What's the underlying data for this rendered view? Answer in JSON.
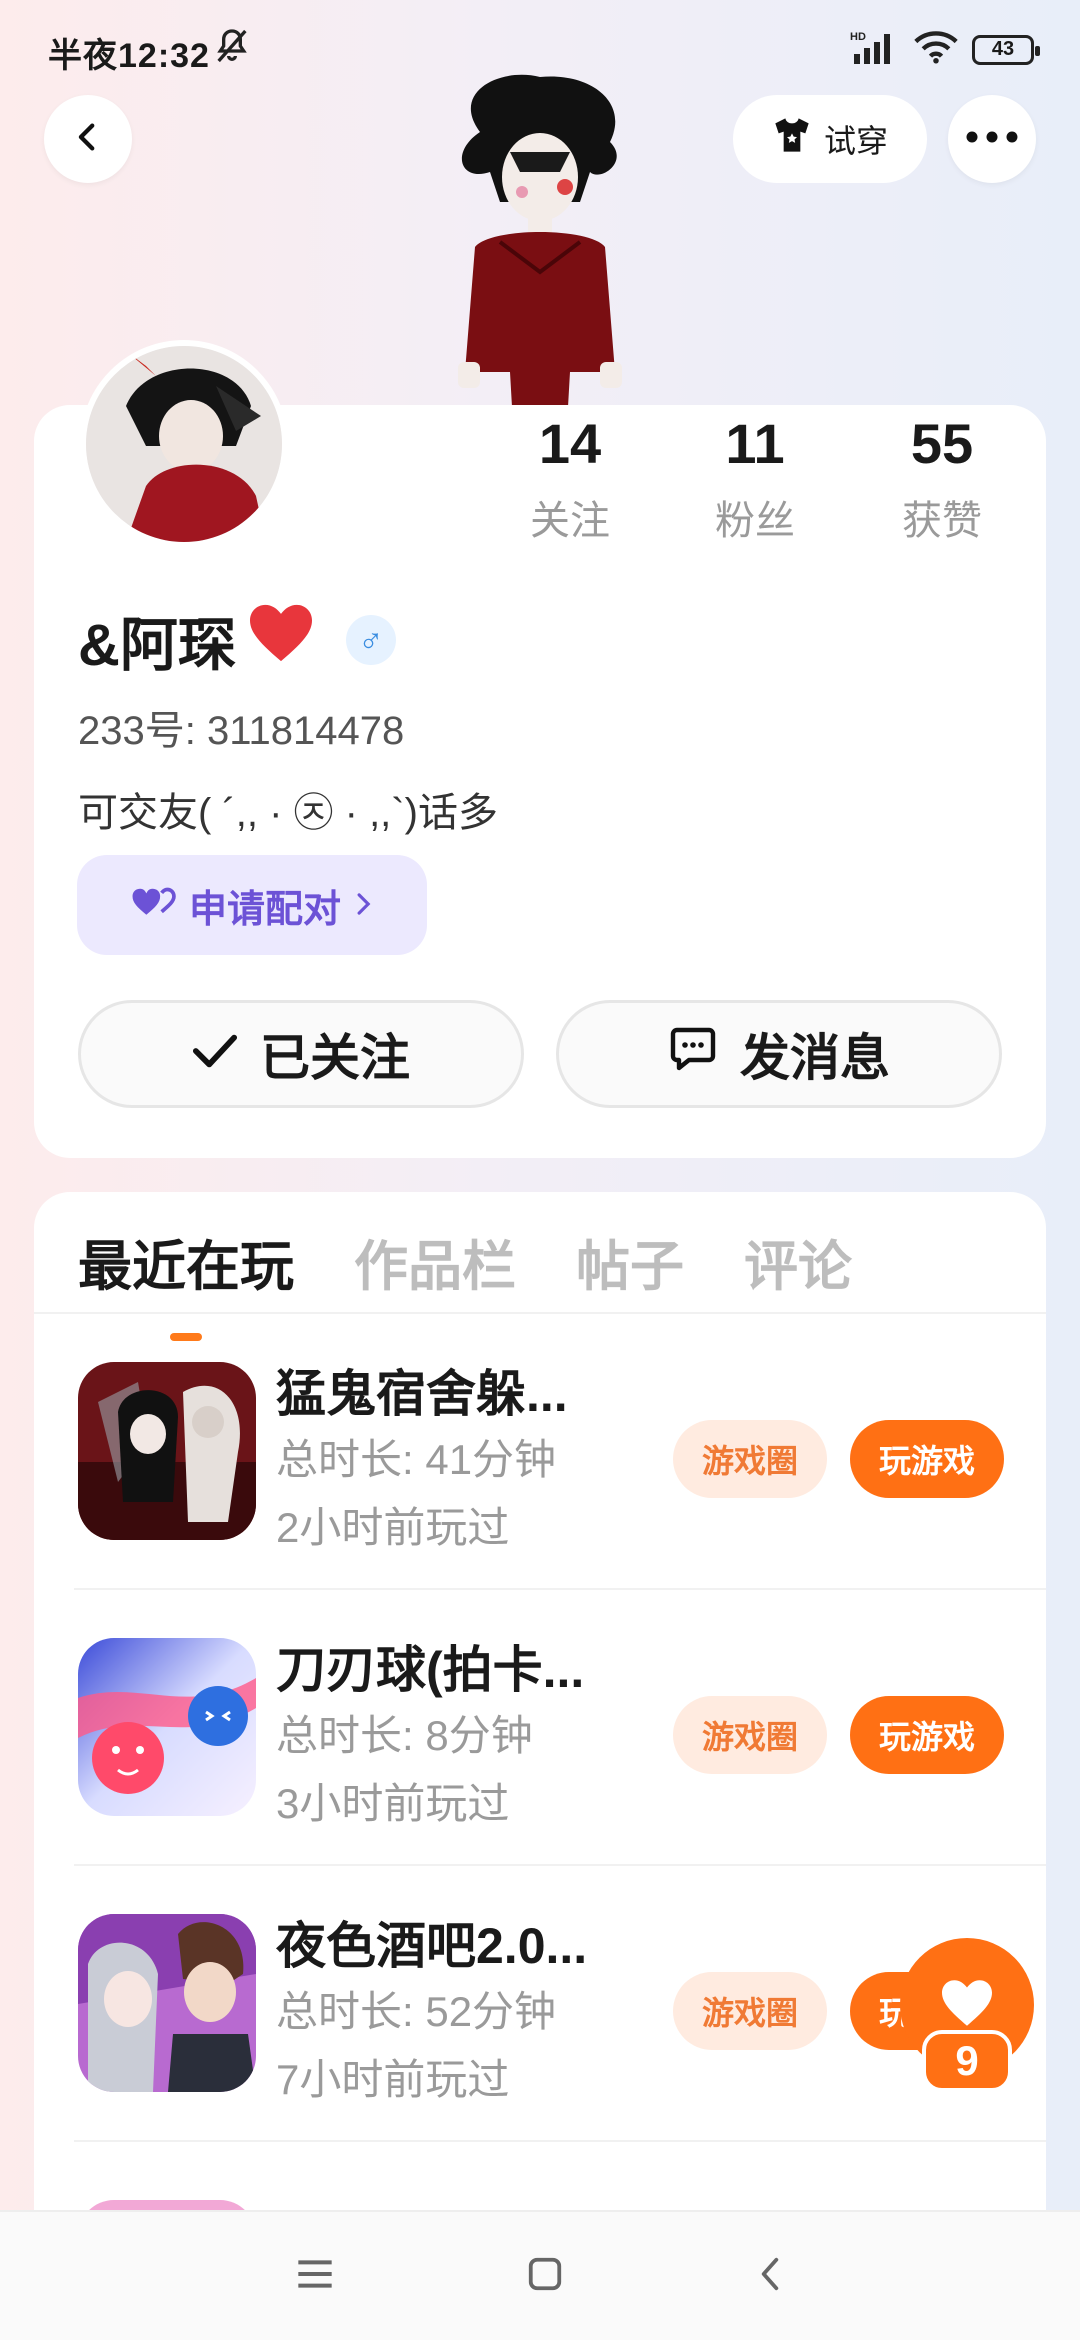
{
  "status_bar": {
    "time": "半夜12:32",
    "battery": "43",
    "hd": "HD"
  },
  "header": {
    "tryon_label": "试穿"
  },
  "profile": {
    "stats": [
      {
        "value": "14",
        "label": "关注"
      },
      {
        "value": "11",
        "label": "粉丝"
      },
      {
        "value": "55",
        "label": "获赞"
      }
    ],
    "nickname": "&阿琛",
    "nickname_emoji": "❤️",
    "gender_symbol": "♂",
    "uid": "233号: 311814478",
    "bio": "可交友( ´,, · ㉨ · ,,`)话多",
    "pair_label": "申请配对",
    "follow_label": "已关注",
    "message_label": "发消息"
  },
  "tabs": [
    "最近在玩",
    "作品栏",
    "帖子",
    "评论"
  ],
  "games": [
    {
      "name": "猛鬼宿舍躲...",
      "duration": "总时长: 41分钟",
      "last_played": "2小时前玩过",
      "circle_label": "游戏圈",
      "play_label": "玩游戏"
    },
    {
      "name": "刀刃球(拍卡...",
      "duration": "总时长: 8分钟",
      "last_played": "3小时前玩过",
      "circle_label": "游戏圈",
      "play_label": "玩游戏"
    },
    {
      "name": "夜色酒吧2.0...",
      "duration": "总时长: 52分钟",
      "last_played": "7小时前玩过",
      "circle_label": "游戏圈",
      "play_label": "玩游戏"
    }
  ],
  "like_fab": {
    "count": "9"
  },
  "colors": {
    "accent": "#ff7014",
    "pair_purple": "#6c52d6",
    "card_bg": "#ffffff"
  }
}
